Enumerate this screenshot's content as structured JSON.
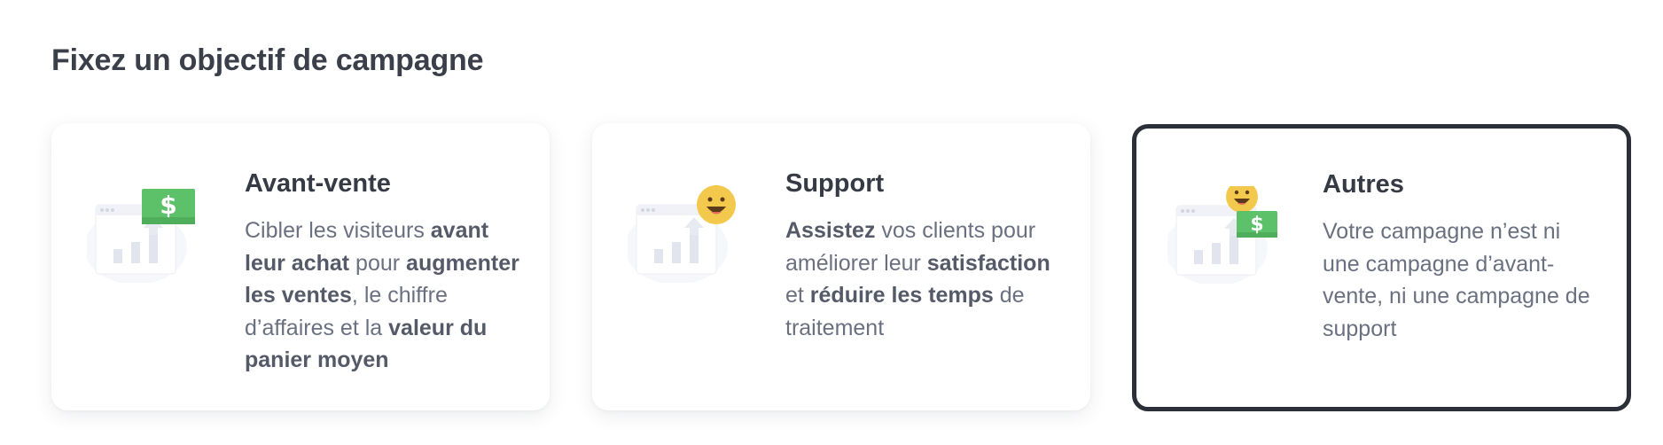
{
  "page": {
    "title": "Fixez un objectif de campagne"
  },
  "cards": [
    {
      "title": "Avant-vente",
      "icon": "money-chart-icon",
      "selected": false,
      "description": [
        {
          "text": "Cibler les visiteurs ",
          "bold": false
        },
        {
          "text": "avant leur achat",
          "bold": true
        },
        {
          "text": " pour ",
          "bold": false
        },
        {
          "text": "augmenter les ventes",
          "bold": true
        },
        {
          "text": ", le chiffre d’affaires et la ",
          "bold": false
        },
        {
          "text": "valeur du panier moyen",
          "bold": true
        }
      ]
    },
    {
      "title": "Support",
      "icon": "smiley-chart-icon",
      "selected": false,
      "description": [
        {
          "text": "Assistez",
          "bold": true
        },
        {
          "text": " vos clients pour améliorer leur ",
          "bold": false
        },
        {
          "text": "satisfaction",
          "bold": true
        },
        {
          "text": " et ",
          "bold": false
        },
        {
          "text": "réduire les temps",
          "bold": true
        },
        {
          "text": " de traitement",
          "bold": false
        }
      ]
    },
    {
      "title": "Autres",
      "icon": "smiley-money-chart-icon",
      "selected": true,
      "description": [
        {
          "text": "Votre campagne n’est ni une campagne d’avant-vente, ni une campagne de support",
          "bold": false
        }
      ]
    }
  ],
  "colors": {
    "money_green": "#5cc168",
    "smiley_yellow": "#f2c94c",
    "selected_border": "#2b2f38"
  }
}
